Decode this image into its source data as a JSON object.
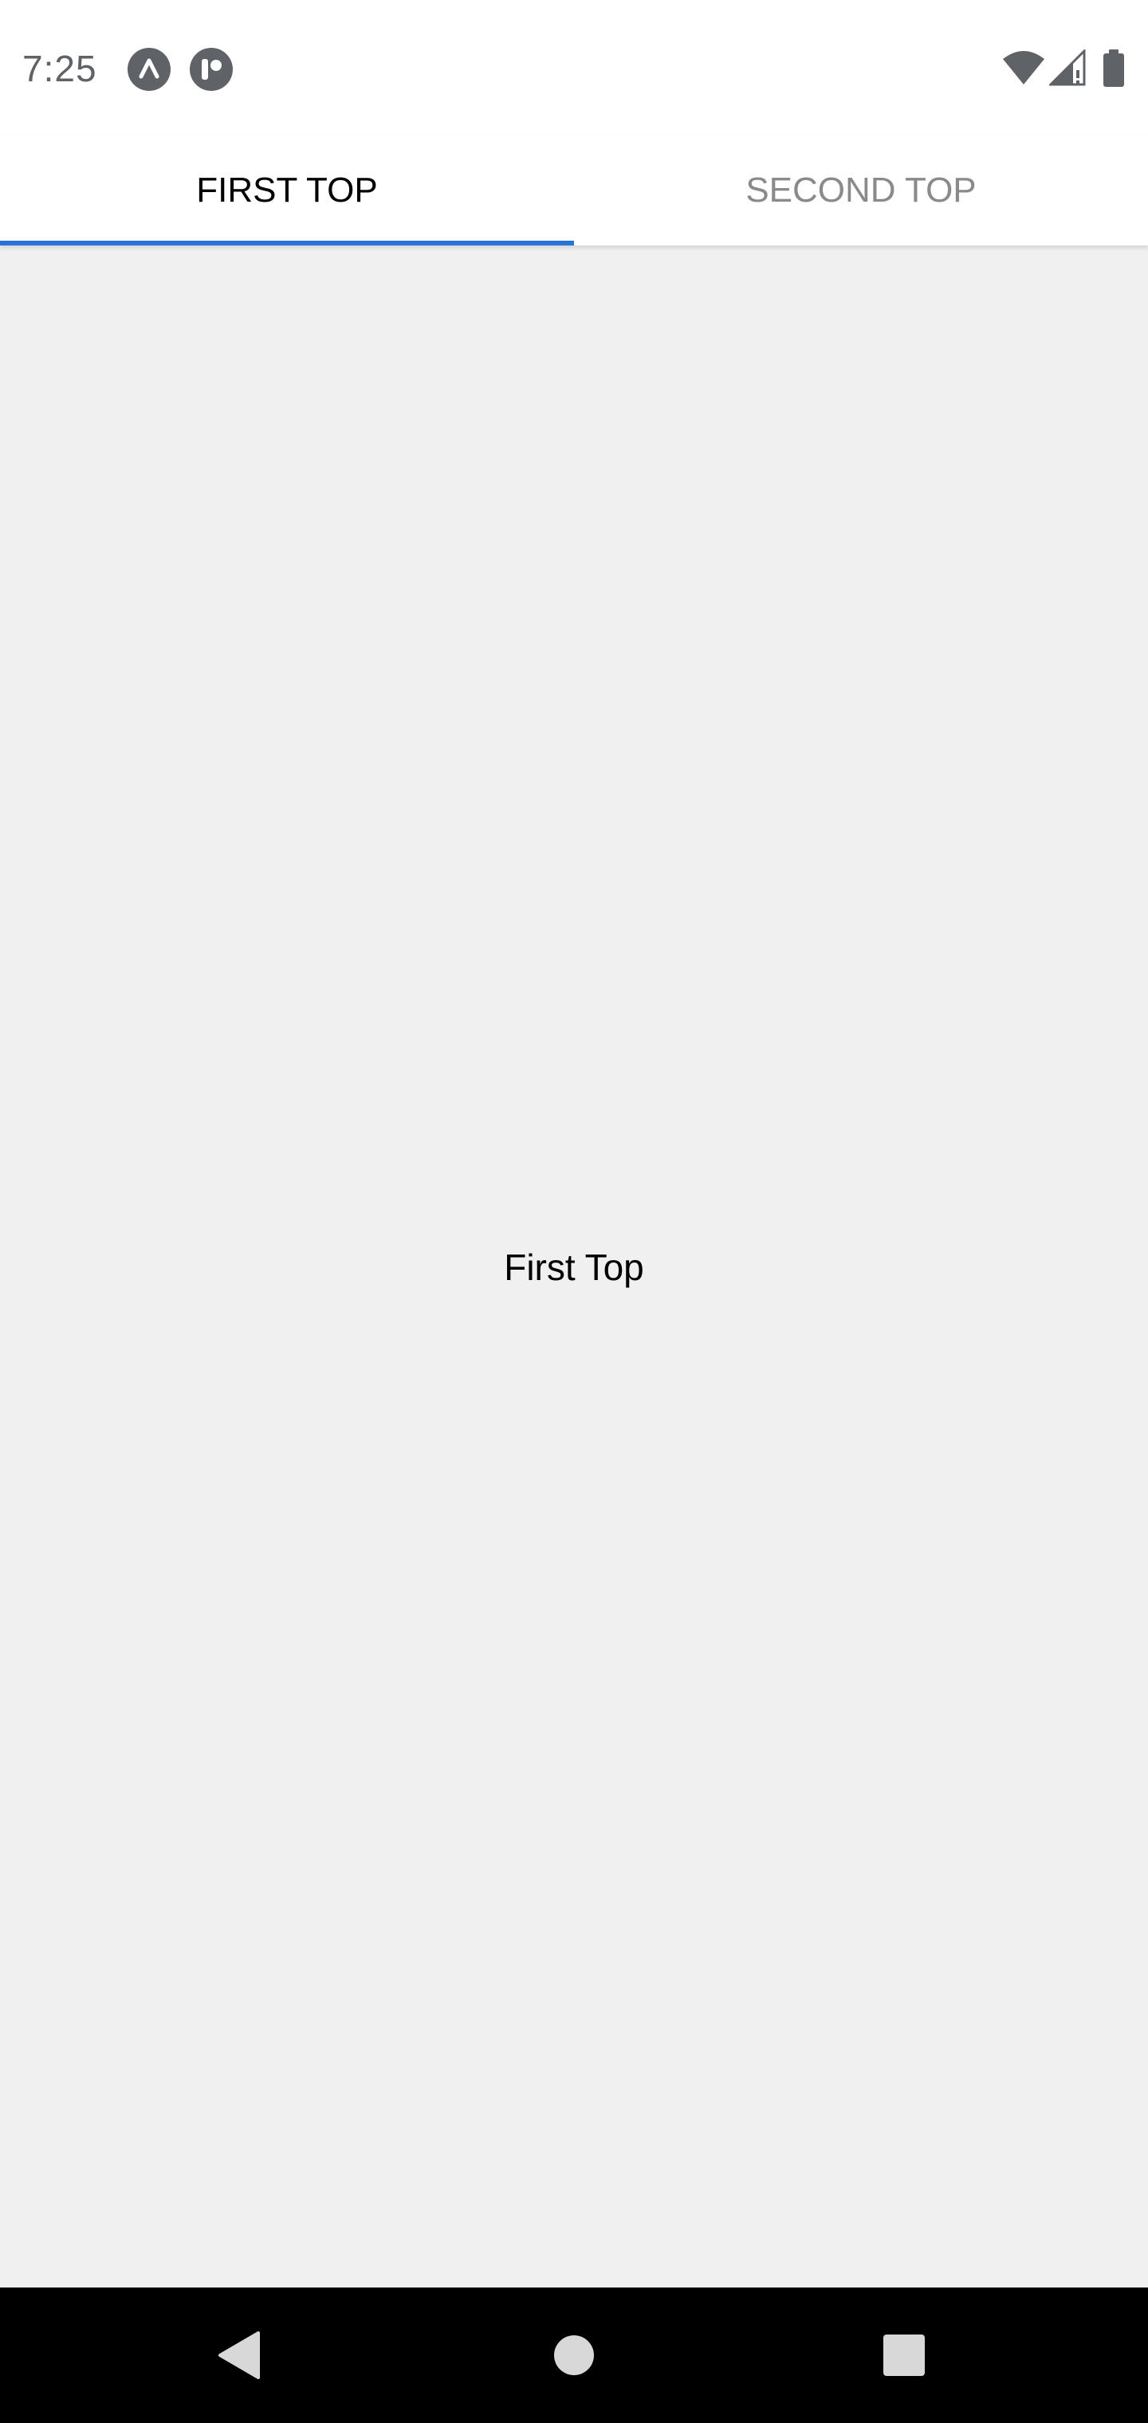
{
  "status_bar": {
    "time": "7:25",
    "left_icons": [
      "expo-icon",
      "app-notification-icon"
    ],
    "right_icons": [
      "wifi-icon",
      "cellular-signal-icon",
      "battery-icon"
    ]
  },
  "tabs": [
    {
      "label": "FIRST TOP",
      "active": true
    },
    {
      "label": "SECOND TOP",
      "active": false
    }
  ],
  "content": {
    "text": "First Top"
  },
  "nav_bar": {
    "buttons": [
      "back-icon",
      "home-icon",
      "recents-icon"
    ]
  },
  "colors": {
    "accent": "#2a72d6",
    "background": "#f0f0f0",
    "tab_bar": "#ffffff",
    "inactive_tab_text": "#8a8a8a",
    "nav_bar": "#000000"
  }
}
